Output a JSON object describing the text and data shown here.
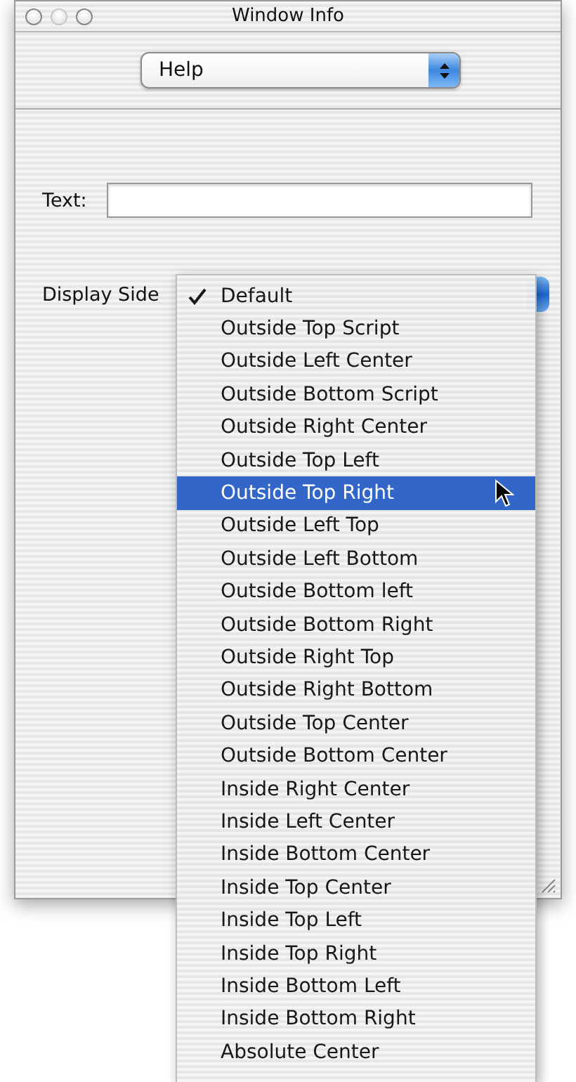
{
  "window": {
    "title": "Window Info"
  },
  "category_popup": {
    "value": "Help"
  },
  "text_field": {
    "label": "Text:"
  },
  "display_side": {
    "label": "Display Side",
    "menu": {
      "items": [
        {
          "label": "Default",
          "checked": true,
          "selected": false
        },
        {
          "label": "Outside Top Script",
          "checked": false,
          "selected": false
        },
        {
          "label": "Outside Left Center",
          "checked": false,
          "selected": false
        },
        {
          "label": "Outside Bottom Script",
          "checked": false,
          "selected": false
        },
        {
          "label": "Outside Right Center",
          "checked": false,
          "selected": false
        },
        {
          "label": "Outside Top Left",
          "checked": false,
          "selected": false
        },
        {
          "label": "Outside Top Right",
          "checked": false,
          "selected": true
        },
        {
          "label": "Outside Left Top",
          "checked": false,
          "selected": false
        },
        {
          "label": "Outside Left Bottom",
          "checked": false,
          "selected": false
        },
        {
          "label": "Outside Bottom left",
          "checked": false,
          "selected": false
        },
        {
          "label": "Outside Bottom Right",
          "checked": false,
          "selected": false
        },
        {
          "label": "Outside Right Top",
          "checked": false,
          "selected": false
        },
        {
          "label": "Outside Right Bottom",
          "checked": false,
          "selected": false
        },
        {
          "label": "Outside Top Center",
          "checked": false,
          "selected": false
        },
        {
          "label": "Outside Bottom Center",
          "checked": false,
          "selected": false
        },
        {
          "label": "Inside Right Center",
          "checked": false,
          "selected": false
        },
        {
          "label": "Inside Left Center",
          "checked": false,
          "selected": false
        },
        {
          "label": "Inside Bottom Center",
          "checked": false,
          "selected": false
        },
        {
          "label": "Inside Top Center",
          "checked": false,
          "selected": false
        },
        {
          "label": "Inside Top Left",
          "checked": false,
          "selected": false
        },
        {
          "label": "Inside Top Right",
          "checked": false,
          "selected": false
        },
        {
          "label": "Inside Bottom Left",
          "checked": false,
          "selected": false
        },
        {
          "label": "Inside Bottom Right",
          "checked": false,
          "selected": false
        },
        {
          "label": "Absolute Center",
          "checked": false,
          "selected": false
        }
      ]
    }
  }
}
